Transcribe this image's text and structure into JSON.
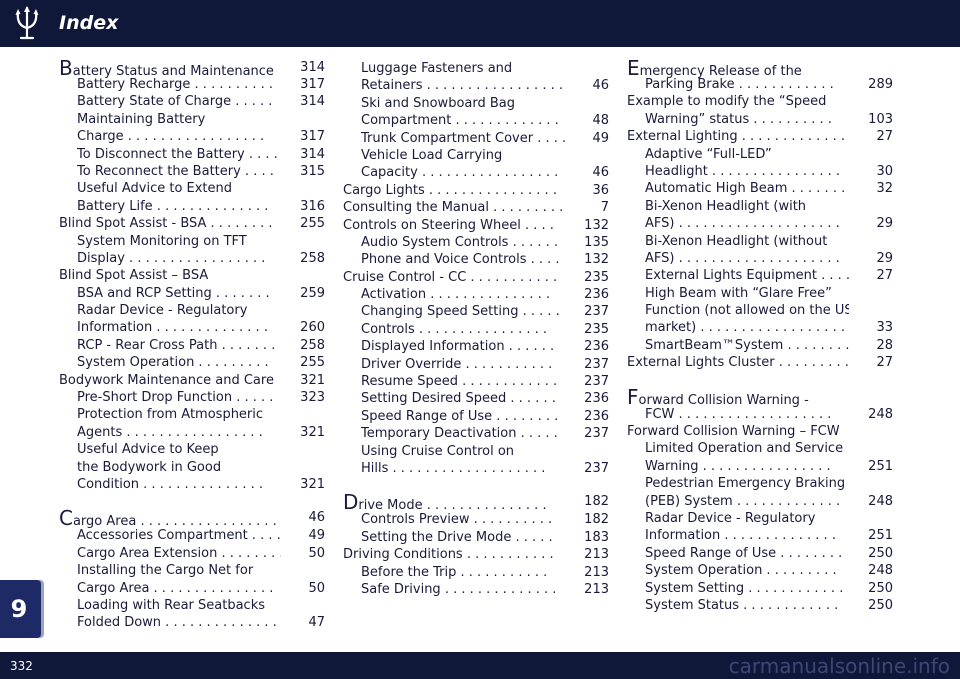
{
  "header": {
    "title": "Index"
  },
  "side_tab": {
    "chapter": "9"
  },
  "footer": {
    "page_number": "332",
    "watermark": "carmanualsonline.info"
  },
  "icons": {
    "logo": "maserati-trident-icon"
  },
  "colors": {
    "bar": "#10183a",
    "tab": "#1e2a66"
  },
  "columns": [
    [
      {
        "text": "Battery Status and Maintenance",
        "dots": false,
        "page": "314",
        "level": 1,
        "drop_cap": "B",
        "rest": "attery Status and Maintenance"
      },
      {
        "text": "Battery Recharge . . . . . . . . . .",
        "page": "317",
        "level": 2
      },
      {
        "text": "Battery State of Charge . . . . .",
        "page": "314",
        "level": 2
      },
      {
        "text": "Maintaining Battery",
        "page": "",
        "level": 2
      },
      {
        "text": "Charge . . . . . . . . . . . . . . . . .",
        "page": "317",
        "level": 2
      },
      {
        "text": "To Disconnect the Battery . . . .",
        "page": "314",
        "level": 2
      },
      {
        "text": "To Reconnect the Battery . . . .",
        "page": "315",
        "level": 2
      },
      {
        "text": "Useful Advice to Extend",
        "page": "",
        "level": 2
      },
      {
        "text": "Battery Life . . . . . . . . . . . . . .",
        "page": "316",
        "level": 2
      },
      {
        "text": "Blind Spot Assist - BSA . . . . . . . .",
        "page": "255",
        "level": 1
      },
      {
        "text": "System Monitoring on TFT",
        "page": "",
        "level": 2
      },
      {
        "text": "Display . . . . . . . . . . . . . . . . .",
        "page": "258",
        "level": 2
      },
      {
        "text": "Blind Spot Assist – BSA",
        "page": "",
        "level": 1
      },
      {
        "text": "BSA and RCP Setting . . . . . . .",
        "page": "259",
        "level": 2
      },
      {
        "text": "Radar Device - Regulatory",
        "page": "",
        "level": 2
      },
      {
        "text": "Information . . . . . . . . . . . . . .",
        "page": "260",
        "level": 2
      },
      {
        "text": "RCP - Rear Cross Path . . . . . . .",
        "page": "258",
        "level": 2
      },
      {
        "text": "System Operation . . . . . . . . .",
        "page": "255",
        "level": 2
      },
      {
        "text": "Bodywork Maintenance and Care",
        "page": "321",
        "level": 1
      },
      {
        "text": "Pre-Short Drop Function . . . . .",
        "page": "323",
        "level": 2
      },
      {
        "text": "Protection from Atmospheric",
        "page": "",
        "level": 2
      },
      {
        "text": "Agents . . . . . . . . . . . . . . . . .",
        "page": "321",
        "level": 2
      },
      {
        "text": "Useful Advice to Keep",
        "page": "",
        "level": 2
      },
      {
        "text": "the Bodywork in Good",
        "page": "",
        "level": 2
      },
      {
        "text": "Condition . . . . . . . . . . . . . . .",
        "page": "321",
        "level": 2
      },
      {
        "text": "Cargo Area . . . . . . . . . . . . . . . . .",
        "page": "46",
        "level": 1,
        "drop_cap": "C",
        "rest": "argo Area . . . . . . . . . . . . . . . . .",
        "section": true
      },
      {
        "text": "Accessories Compartment . . . . .",
        "page": "49",
        "level": 2
      },
      {
        "text": "Cargo Area Extension . . . . . . . .",
        "page": "50",
        "level": 2
      },
      {
        "text": "Installing the Cargo Net for",
        "page": "",
        "level": 2
      },
      {
        "text": "Cargo Area . . . . . . . . . . . . . . .",
        "page": "50",
        "level": 2
      },
      {
        "text": "Loading with Rear Seatbacks",
        "page": "",
        "level": 2
      },
      {
        "text": "Folded Down . . . . . . . . . . . . . .",
        "page": "47",
        "level": 2
      }
    ],
    [
      {
        "text": "Luggage Fasteners and",
        "page": "",
        "level": 2
      },
      {
        "text": "Retainers . . . . . . . . . . . . . . . . .",
        "page": "46",
        "level": 2
      },
      {
        "text": "Ski and Snowboard Bag",
        "page": "",
        "level": 2
      },
      {
        "text": "Compartment . . . . . . . . . . . . .",
        "page": "48",
        "level": 2
      },
      {
        "text": "Trunk Compartment Cover . . . .",
        "page": "49",
        "level": 2
      },
      {
        "text": "Vehicle Load Carrying",
        "page": "",
        "level": 2
      },
      {
        "text": "Capacity . . . . . . . . . . . . . . . . .",
        "page": "46",
        "level": 2
      },
      {
        "text": "Cargo Lights . . . . . . . . . . . . . . . .",
        "page": "36",
        "level": 1
      },
      {
        "text": "Consulting the Manual . . . . . . . . . .",
        "page": "7",
        "level": 1
      },
      {
        "text": "Controls on Steering Wheel . . . .",
        "page": "132",
        "level": 1
      },
      {
        "text": "Audio System Controls . . . . . .",
        "page": "135",
        "level": 2
      },
      {
        "text": "Phone and Voice Controls . . . .",
        "page": "132",
        "level": 2
      },
      {
        "text": "Cruise Control - CC . . . . . . . . . . .",
        "page": "235",
        "level": 1
      },
      {
        "text": "Activation . . . . . . . . . . . . . . .",
        "page": "236",
        "level": 2
      },
      {
        "text": "Changing Speed Setting . . . . .",
        "page": "237",
        "level": 2
      },
      {
        "text": "Controls . . . . . . . . . . . . . . . .",
        "page": "235",
        "level": 2
      },
      {
        "text": "Displayed Information . . . . . .",
        "page": "236",
        "level": 2
      },
      {
        "text": "Driver Override . . . . . . . . . . .",
        "page": "237",
        "level": 2
      },
      {
        "text": "Resume Speed . . . . . . . . . . . .",
        "page": "237",
        "level": 2
      },
      {
        "text": "Setting Desired Speed . . . . . .",
        "page": "236",
        "level": 2
      },
      {
        "text": "Speed Range of Use . . . . . . . .",
        "page": "236",
        "level": 2
      },
      {
        "text": "Temporary Deactivation . . . . .",
        "page": "237",
        "level": 2
      },
      {
        "text": "Using Cruise Control on",
        "page": "",
        "level": 2
      },
      {
        "text": "Hills . . . . . . . . . . . . . . . . . . .",
        "page": "237",
        "level": 2
      },
      {
        "text": "Drive Mode . . . . . . . . . . . . . . .",
        "page": "182",
        "level": 1,
        "drop_cap": "D",
        "rest": "rive Mode . . . . . . . . . . . . . . .",
        "section": true
      },
      {
        "text": "Controls Preview . . . . . . . . . .",
        "page": "182",
        "level": 2
      },
      {
        "text": "Setting the Drive Mode . . . . .",
        "page": "183",
        "level": 2
      },
      {
        "text": "Driving Conditions . . . . . . . . . . .",
        "page": "213",
        "level": 1
      },
      {
        "text": "Before the Trip . . . . . . . . . . .",
        "page": "213",
        "level": 2
      },
      {
        "text": "Safe Driving . . . . . . . . . . . . . .",
        "page": "213",
        "level": 2
      }
    ],
    [
      {
        "text": "Emergency Release of the",
        "page": "",
        "level": 1,
        "drop_cap": "E",
        "rest": "mergency Release of the"
      },
      {
        "text": "Parking Brake . . . . . . . . . . . .",
        "page": "289",
        "level": 2
      },
      {
        "text": "Example to modify the “Speed",
        "page": "",
        "level": 1
      },
      {
        "text": "Warning” status . . . . . . . . . .",
        "page": "103",
        "level": 2
      },
      {
        "text": "External Lighting . . . . . . . . . . . . .",
        "page": "27",
        "level": 1
      },
      {
        "text": "Adaptive “Full-LED”",
        "page": "",
        "level": 2
      },
      {
        "text": "Headlight . . . . . . . . . . . . . . . .",
        "page": "30",
        "level": 2
      },
      {
        "text": "Automatic High Beam . . . . . . .",
        "page": "32",
        "level": 2
      },
      {
        "text": "Bi-Xenon Headlight (with",
        "page": "",
        "level": 2
      },
      {
        "text": "AFS) . . . . . . . . . . . . . . . . . . . .",
        "page": "29",
        "level": 2
      },
      {
        "text": "Bi-Xenon Headlight (without",
        "page": "",
        "level": 2
      },
      {
        "text": "AFS) . . . . . . . . . . . . . . . . . . . .",
        "page": "29",
        "level": 2
      },
      {
        "text": "External Lights Equipment . . . .",
        "page": "27",
        "level": 2
      },
      {
        "text": "High Beam with “Glare Free”",
        "page": "",
        "level": 2
      },
      {
        "text": "Function (not allowed on the US",
        "page": "",
        "level": 2
      },
      {
        "text": "market) . . . . . . . . . . . . . . . . . .",
        "page": "33",
        "level": 2
      },
      {
        "text": "SmartBeam™System . . . . . . . . .",
        "page": "28",
        "level": 2
      },
      {
        "text": "External Lights Cluster . . . . . . . . .",
        "page": "27",
        "level": 1
      },
      {
        "text": "Forward Collision Warning -",
        "page": "",
        "level": 1,
        "drop_cap": "F",
        "rest": "orward Collision Warning -",
        "section": true
      },
      {
        "text": "FCW . . . . . . . . . . . . . . . . . . .",
        "page": "248",
        "level": 2
      },
      {
        "text": "Forward Collision Warning – FCW",
        "page": "",
        "level": 1
      },
      {
        "text": "Limited Operation and Service",
        "page": "",
        "level": 2
      },
      {
        "text": "Warning . . . . . . . . . . . . . . . .",
        "page": "251",
        "level": 2
      },
      {
        "text": "Pedestrian Emergency Braking",
        "page": "",
        "level": 2
      },
      {
        "text": "(PEB) System . . . . . . . . . . . . .",
        "page": "248",
        "level": 2
      },
      {
        "text": "Radar Device - Regulatory",
        "page": "",
        "level": 2
      },
      {
        "text": "Information . . . . . . . . . . . . . .",
        "page": "251",
        "level": 2
      },
      {
        "text": "Speed Range of Use . . . . . . . .",
        "page": "250",
        "level": 2
      },
      {
        "text": "System Operation . . . . . . . . .",
        "page": "248",
        "level": 2
      },
      {
        "text": "System Setting . . . . . . . . . . . .",
        "page": "250",
        "level": 2
      },
      {
        "text": "System Status . . . . . . . . . . . .",
        "page": "250",
        "level": 2
      }
    ]
  ]
}
